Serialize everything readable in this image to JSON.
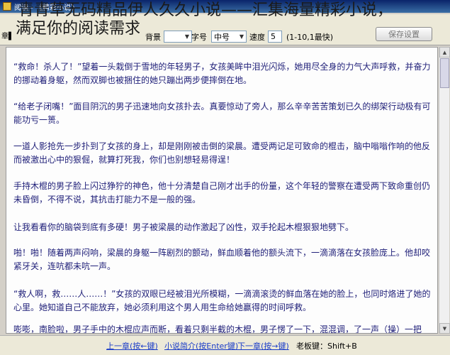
{
  "window": {
    "title": "阅读 - 《精彩小说》"
  },
  "overlay": {
    "line1": "青青草无码精品伊人久久小说——汇集海量精彩小说，",
    "line2": "满足你的阅读需求"
  },
  "toolbar": {
    "menu_label": "章▌",
    "bg_label": "背景",
    "bg_value": "",
    "font_label": "字号",
    "font_value": "中号",
    "speed_label": "速度",
    "speed_value": "5",
    "speed_hint": "(1-10,1最快)",
    "settings_button": "保存设置"
  },
  "content": {
    "paragraphs": [
      "“救命！杀人了！”望着一头栽倒于雪地的年轻男子，女孩美眸中泪光闪烁，她用尽全身的力气大声呼救，并奋力的挪动着身躯，然而双脚也被捆住的她只蹦出两步便摔倒在地。",
      "“给老子闭嘴！”面目阴沉的男子迅速地向女孩扑去。真要惊动了旁人，那么辛辛苦苦策划已久的绑架行动极有可能功亏一篑。",
      "一道人影抢先一步扑到了女孩的身上，却是刚刚被击倒的梁晨。遭受两记足可致命的棍击，脑中嗡嗡作响的他反而被激出心中的狠倔，就算打死我，你们也别想轻易得逞！",
      "手持木棍的男子脸上闪过狰狞的神色，他十分清楚自己刚才出手的份量，这个年轻的警察在遭受两下致命重创仍未昏倒，不得不说，其抗击打能力不是一般的强。",
      "让我看看你的脑袋到底有多硬！男子被梁晨的动作激起了凶性，双手抡起木棍狠狠地劈下。",
      "啪！啪！随着两声闷响，梁晨的身躯一阵剧烈的颤动，鲜血顺着他的额头流下，一滴滴落在女孩脸庞上。他却咬紧牙关，连吭都未吭一声。",
      "“救人啊，救……人……！”女孩的双眼已经被泪光所模糊，一滴滴滚烫的鲜血落在她的脸上，也同时烙进了她的心里。她知道自己不能放弃，她必须利用这个男人用生命给她赢得的时间呼救。",
      "嘭嘭，南脸啦，男子手中的木棍应声而断，看着只剩半截的木棍，男子愣了一下，混混调，了一声（操）一把"
    ]
  },
  "statusbar": {
    "prev": "上一章(按←键)",
    "intro": "小说简介(按Enter键)",
    "next": "下一章(按→键)",
    "boss_key": "老板键：Shift+B"
  }
}
